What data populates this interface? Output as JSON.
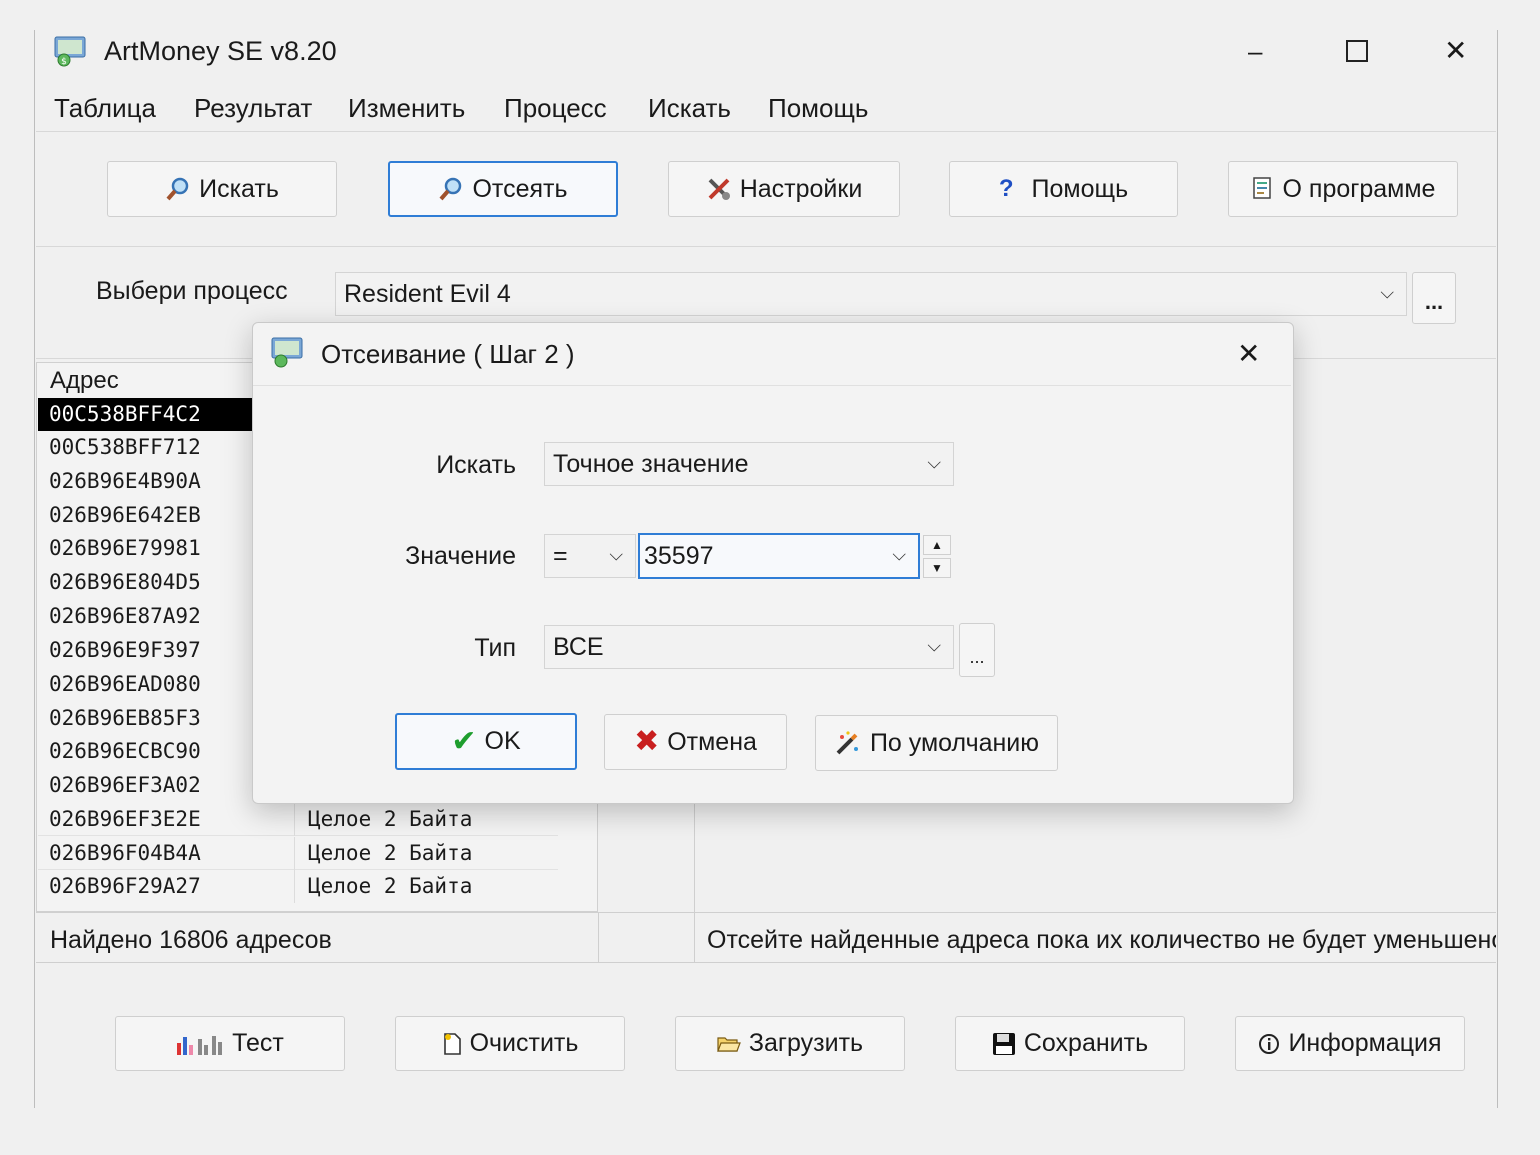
{
  "window": {
    "title": "ArtMoney SE v8.20",
    "controls": {
      "minimize": "–",
      "maximize": "☐",
      "close": "✕"
    }
  },
  "menu": [
    "Таблица",
    "Результат",
    "Изменить",
    "Процесс",
    "Искать",
    "Помощь"
  ],
  "toolbar": {
    "search": "Искать",
    "filter": "Отсеять",
    "settings": "Настройки",
    "help": "Помощь",
    "about": "О программе"
  },
  "process": {
    "label": "Выбери процесс",
    "value": "Resident Evil 4",
    "browse": "..."
  },
  "table": {
    "header_address": "Адрес",
    "rows": [
      {
        "address": "00C538BFF4C2",
        "type": ""
      },
      {
        "address": "00C538BFF712",
        "type": ""
      },
      {
        "address": "026B96E4B90A",
        "type": ""
      },
      {
        "address": "026B96E642EB",
        "type": ""
      },
      {
        "address": "026B96E79981",
        "type": ""
      },
      {
        "address": "026B96E804D5",
        "type": ""
      },
      {
        "address": "026B96E87A92",
        "type": ""
      },
      {
        "address": "026B96E9F397",
        "type": ""
      },
      {
        "address": "026B96EAD080",
        "type": ""
      },
      {
        "address": "026B96EB85F3",
        "type": ""
      },
      {
        "address": "026B96ECBC90",
        "type": ""
      },
      {
        "address": "026B96EF3A02",
        "type": ""
      },
      {
        "address": "026B96EF3E2E",
        "type": "Целое 2 Байта"
      },
      {
        "address": "026B96F04B4A",
        "type": "Целое 2 Байта"
      },
      {
        "address": "026B96F29A27",
        "type": "Целое 2 Байта"
      }
    ],
    "status_found": "Найдено 16806 адресов",
    "status_hint": "Отсейте найденные адреса пока их количество не будет уменьшено"
  },
  "dialog": {
    "title": "Отсеивание ( Шаг 2 )",
    "close": "✕",
    "search_label": "Искать",
    "search_value": "Точное значение",
    "value_label": "Значение",
    "operator": "=",
    "value": "35597",
    "type_label": "Тип",
    "type_value": "ВСЕ",
    "type_more": "...",
    "ok": "OK",
    "cancel": "Отмена",
    "default": "По умолчанию"
  },
  "bottom": {
    "test": "Тест",
    "clear": "Очистить",
    "load": "Загрузить",
    "save": "Сохранить",
    "info": "Информация"
  },
  "colors": {
    "accent": "#2f7dd6",
    "selection": "#000000",
    "ok_check": "#1e9e2e",
    "cancel_x": "#c81e1e"
  }
}
